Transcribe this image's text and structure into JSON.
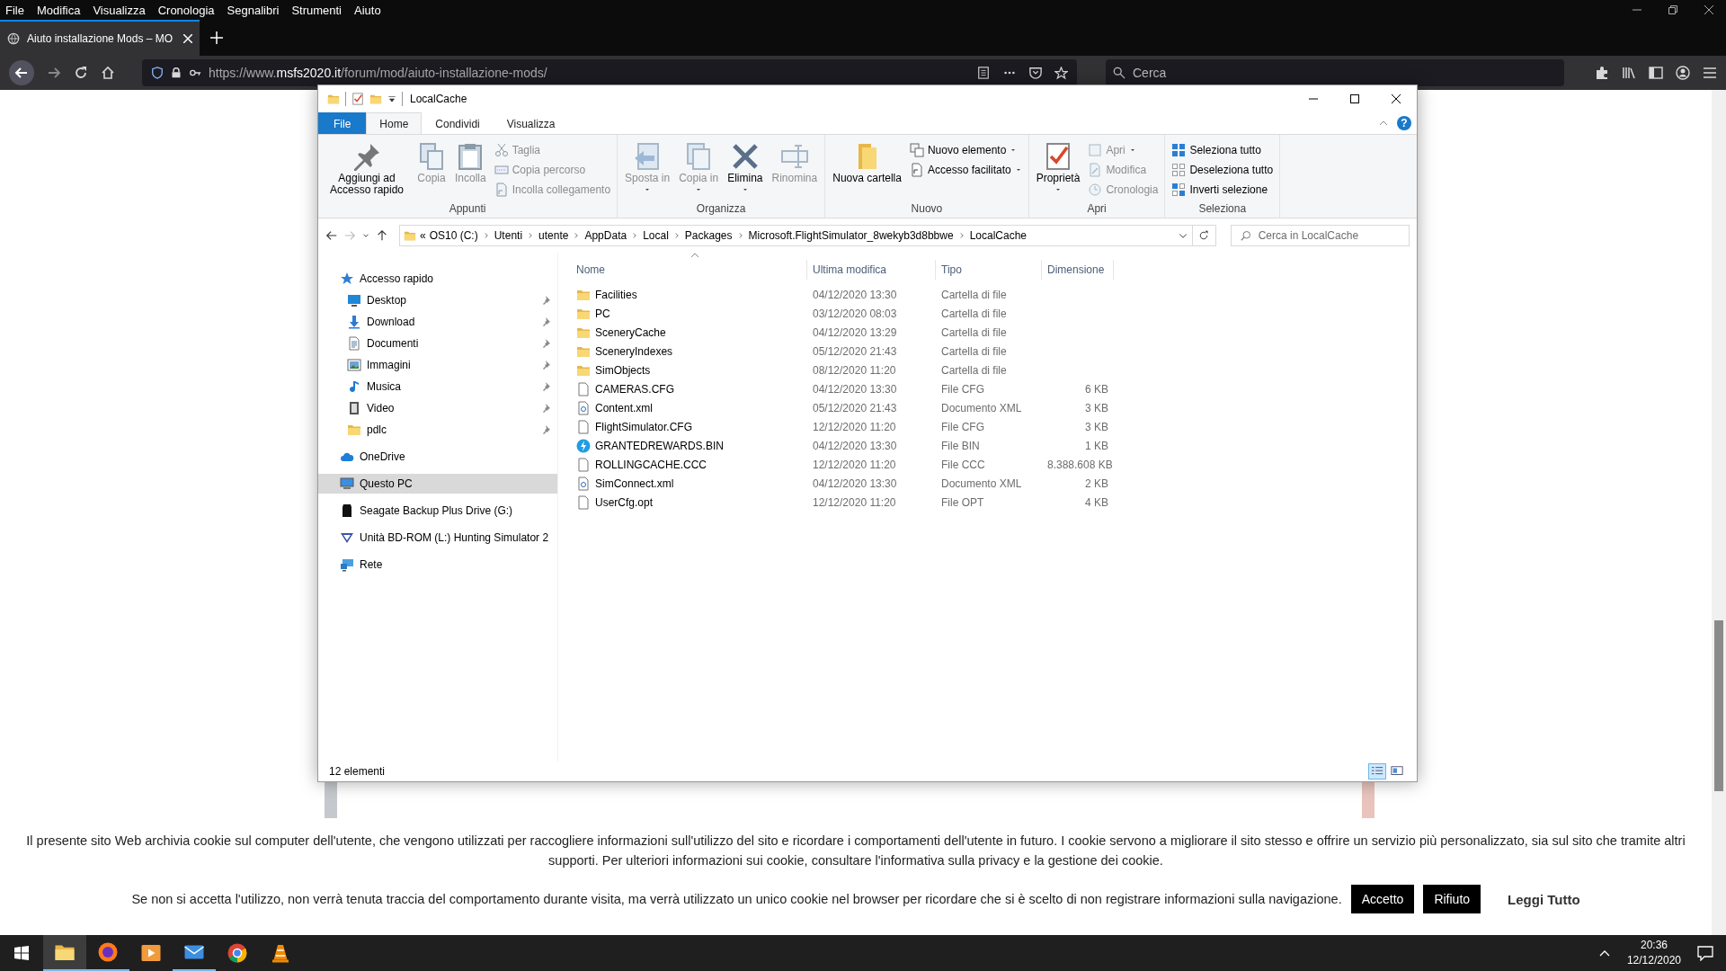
{
  "browser": {
    "menu": [
      "File",
      "Modifica",
      "Visualizza",
      "Cronologia",
      "Segnalibri",
      "Strumenti",
      "Aiuto"
    ],
    "tab": {
      "title": "Aiuto installazione Mods – MO"
    },
    "url": {
      "scheme": "https://www.",
      "domain": "msfs2020.it",
      "path": "/forum/mod/aiuto-installazione-mods/"
    },
    "search": {
      "placeholder": "Cerca"
    }
  },
  "explorer": {
    "title": "LocalCache",
    "ribbon_tabs": [
      {
        "label": "File",
        "kind": "file",
        "selected": false
      },
      {
        "label": "Home",
        "kind": "tab",
        "selected": true
      },
      {
        "label": "Condividi",
        "kind": "tab",
        "selected": false
      },
      {
        "label": "Visualizza",
        "kind": "tab",
        "selected": false
      }
    ],
    "help": "?",
    "ribbon_groups": [
      {
        "label": "Appunti",
        "items": [
          {
            "label": "Aggiungi ad Accesso rapido",
            "kind": "large",
            "disabled": false,
            "dropdown": false
          },
          {
            "label": "Copia",
            "kind": "large",
            "disabled": true,
            "dropdown": false
          },
          {
            "label": "Incolla",
            "kind": "large",
            "disabled": true,
            "dropdown": false
          },
          {
            "label": "Taglia",
            "kind": "small",
            "disabled": true,
            "dropdown": false
          },
          {
            "label": "Copia percorso",
            "kind": "small",
            "disabled": true,
            "dropdown": false
          },
          {
            "label": "Incolla collegamento",
            "kind": "small",
            "disabled": true,
            "dropdown": false
          }
        ]
      },
      {
        "label": "Organizza",
        "items": [
          {
            "label": "Sposta in",
            "kind": "large",
            "disabled": true,
            "dropdown": true
          },
          {
            "label": "Copia in",
            "kind": "large",
            "disabled": true,
            "dropdown": true
          },
          {
            "label": "Elimina",
            "kind": "large",
            "disabled": false,
            "dropdown": true
          },
          {
            "label": "Rinomina",
            "kind": "large",
            "disabled": true,
            "dropdown": false
          }
        ]
      },
      {
        "label": "Nuovo",
        "items": [
          {
            "label": "Nuova cartella",
            "kind": "large",
            "disabled": false,
            "dropdown": false
          },
          {
            "label": "Nuovo elemento",
            "kind": "small",
            "disabled": false,
            "dropdown": true
          },
          {
            "label": "Accesso facilitato",
            "kind": "small",
            "disabled": false,
            "dropdown": true
          }
        ]
      },
      {
        "label": "Apri",
        "items": [
          {
            "label": "Proprietà",
            "kind": "large",
            "disabled": false,
            "dropdown": true
          },
          {
            "label": "Apri",
            "kind": "small",
            "disabled": true,
            "dropdown": true
          },
          {
            "label": "Modifica",
            "kind": "small",
            "disabled": true,
            "dropdown": false
          },
          {
            "label": "Cronologia",
            "kind": "small",
            "disabled": true,
            "dropdown": false
          }
        ]
      },
      {
        "label": "Seleziona",
        "items": [
          {
            "label": "Seleziona tutto",
            "kind": "small",
            "disabled": false,
            "dropdown": false
          },
          {
            "label": "Deseleziona tutto",
            "kind": "small",
            "disabled": false,
            "dropdown": false
          },
          {
            "label": "Inverti selezione",
            "kind": "small",
            "disabled": false,
            "dropdown": false
          }
        ]
      }
    ],
    "address": {
      "overflow": "«",
      "crumbs": [
        "OS10 (C:)",
        "Utenti",
        "utente",
        "AppData",
        "Local",
        "Packages",
        "Microsoft.FlightSimulator_8wekyb3d8bbwe",
        "LocalCache"
      ]
    },
    "search": {
      "placeholder": "Cerca in LocalCache"
    },
    "nav": [
      {
        "label": "Accesso rapido",
        "kind": "star",
        "selected": false,
        "children": [
          {
            "label": "Desktop",
            "kind": "desktop",
            "pinned": true,
            "selected": false
          },
          {
            "label": "Download",
            "kind": "download",
            "pinned": true,
            "selected": false
          },
          {
            "label": "Documenti",
            "kind": "documents",
            "pinned": true,
            "selected": false
          },
          {
            "label": "Immagini",
            "kind": "pictures",
            "pinned": true,
            "selected": false
          },
          {
            "label": "Musica",
            "kind": "music",
            "pinned": true,
            "selected": false
          },
          {
            "label": "Video",
            "kind": "video",
            "pinned": true,
            "selected": false
          },
          {
            "label": "pdlc",
            "kind": "folder",
            "pinned": true,
            "selected": false
          }
        ]
      },
      {
        "label": "OneDrive",
        "kind": "cloud",
        "selected": false
      },
      {
        "label": "Questo PC",
        "kind": "pc",
        "selected": true
      },
      {
        "label": "Seagate Backup Plus Drive (G:)",
        "kind": "drive",
        "selected": false
      },
      {
        "label": "Unità BD-ROM (L:) Hunting Simulator 2",
        "kind": "disc",
        "selected": false
      },
      {
        "label": "Rete",
        "kind": "network",
        "selected": false
      }
    ],
    "columns": [
      "Nome",
      "Ultima modifica",
      "Tipo",
      "Dimensione"
    ],
    "files": [
      {
        "name": "Facilities",
        "modified": "04/12/2020 13:30",
        "type": "Cartella di file",
        "kind": "folder"
      },
      {
        "name": "PC",
        "modified": "03/12/2020 08:03",
        "type": "Cartella di file",
        "kind": "folder"
      },
      {
        "name": "SceneryCache",
        "modified": "04/12/2020 13:29",
        "type": "Cartella di file",
        "kind": "folder"
      },
      {
        "name": "SceneryIndexes",
        "modified": "05/12/2020 21:43",
        "type": "Cartella di file",
        "kind": "folder"
      },
      {
        "name": "SimObjects",
        "modified": "08/12/2020 11:20",
        "type": "Cartella di file",
        "kind": "folder"
      },
      {
        "name": "CAMERAS.CFG",
        "modified": "04/12/2020 13:30",
        "type": "File CFG",
        "size": "6 KB",
        "kind": "file"
      },
      {
        "name": "Content.xml",
        "modified": "05/12/2020 21:43",
        "type": "Documento XML",
        "size": "3 KB",
        "kind": "xml"
      },
      {
        "name": "FlightSimulator.CFG",
        "modified": "12/12/2020 11:20",
        "type": "File CFG",
        "size": "3 KB",
        "kind": "file"
      },
      {
        "name": "GRANTEDREWARDS.BIN",
        "modified": "04/12/2020 13:30",
        "type": "File BIN",
        "size": "1 KB",
        "kind": "bin"
      },
      {
        "name": "ROLLINGCACHE.CCC",
        "modified": "12/12/2020 11:20",
        "type": "File CCC",
        "size": "8.388.608 KB",
        "kind": "file"
      },
      {
        "name": "SimConnect.xml",
        "modified": "04/12/2020 13:30",
        "type": "Documento XML",
        "size": "2 KB",
        "kind": "xml"
      },
      {
        "name": "UserCfg.opt",
        "modified": "12/12/2020 11:20",
        "type": "File OPT",
        "size": "4 KB",
        "kind": "file"
      }
    ],
    "status": "12 elementi",
    "views": [
      {
        "kind": "details",
        "selected": true
      },
      {
        "kind": "tiles",
        "selected": false
      }
    ]
  },
  "cookie": {
    "text": "Il presente sito Web archivia cookie sul computer dell'utente, che vengono utilizzati per raccogliere informazioni sull'utilizzo del sito e ricordare i comportamenti dell'utente in futuro. I cookie servono a migliorare il sito stesso e offrire un servizio più personalizzato, sia sul sito che tramite altri supporti. Per ulteriori informazioni sui cookie, consultare l'informativa sulla privacy e la gestione dei cookie.",
    "notice": "Se non si accetta l'utilizzo, non verrà tenuta traccia del comportamento durante visita, ma verrà utilizzato un unico cookie nel browser per ricordare che si è scelto di non registrare informazioni sulla navigazione.",
    "buttons": [
      "Accetto",
      "Rifiuto"
    ],
    "link": "Leggi Tutto"
  },
  "taskbar": {
    "apps": [
      {
        "kind": "explorer",
        "active": true,
        "running": true
      },
      {
        "kind": "firefox",
        "active": false,
        "running": true
      },
      {
        "kind": "media",
        "active": false,
        "running": false
      },
      {
        "kind": "mail",
        "active": false,
        "running": true
      },
      {
        "kind": "chrome",
        "active": false,
        "running": false
      },
      {
        "kind": "vlc",
        "active": false,
        "running": false
      }
    ],
    "time": "20:36",
    "date": "12/12/2020"
  }
}
